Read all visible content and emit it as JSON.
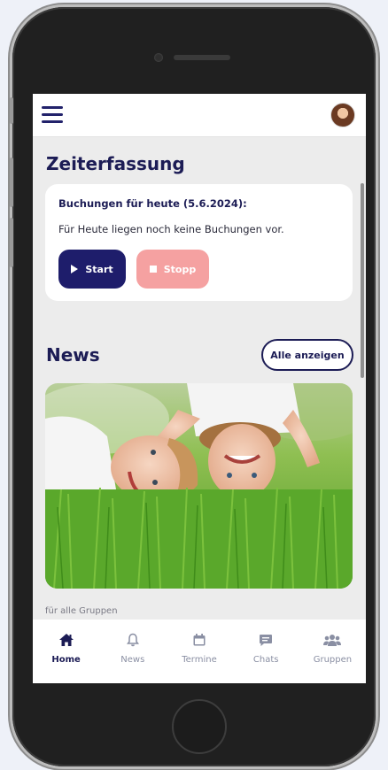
{
  "header": {
    "menu_icon": "hamburger-icon",
    "avatar": "user-avatar"
  },
  "zeiterfassung": {
    "title": "Zeiterfassung",
    "card_title": "Buchungen für heute (5.6.2024):",
    "card_text": "Für Heute liegen noch keine Buchungen vor.",
    "start_label": "Start",
    "stop_label": "Stopp"
  },
  "news": {
    "title": "News",
    "show_all_label": "Alle anzeigen",
    "image": "children-lying-in-grass-photo",
    "group_label": "für alle Gruppen"
  },
  "nav": {
    "items": [
      {
        "label": "Home",
        "icon": "home-icon",
        "active": true
      },
      {
        "label": "News",
        "icon": "bell-icon",
        "active": false
      },
      {
        "label": "Termine",
        "icon": "calendar-icon",
        "active": false
      },
      {
        "label": "Chats",
        "icon": "chat-icon",
        "active": false
      },
      {
        "label": "Gruppen",
        "icon": "group-icon",
        "active": false
      }
    ]
  },
  "colors": {
    "primary": "#1e1d6b",
    "stop": "#f5a1a1",
    "inactive": "#8a8fa3"
  }
}
